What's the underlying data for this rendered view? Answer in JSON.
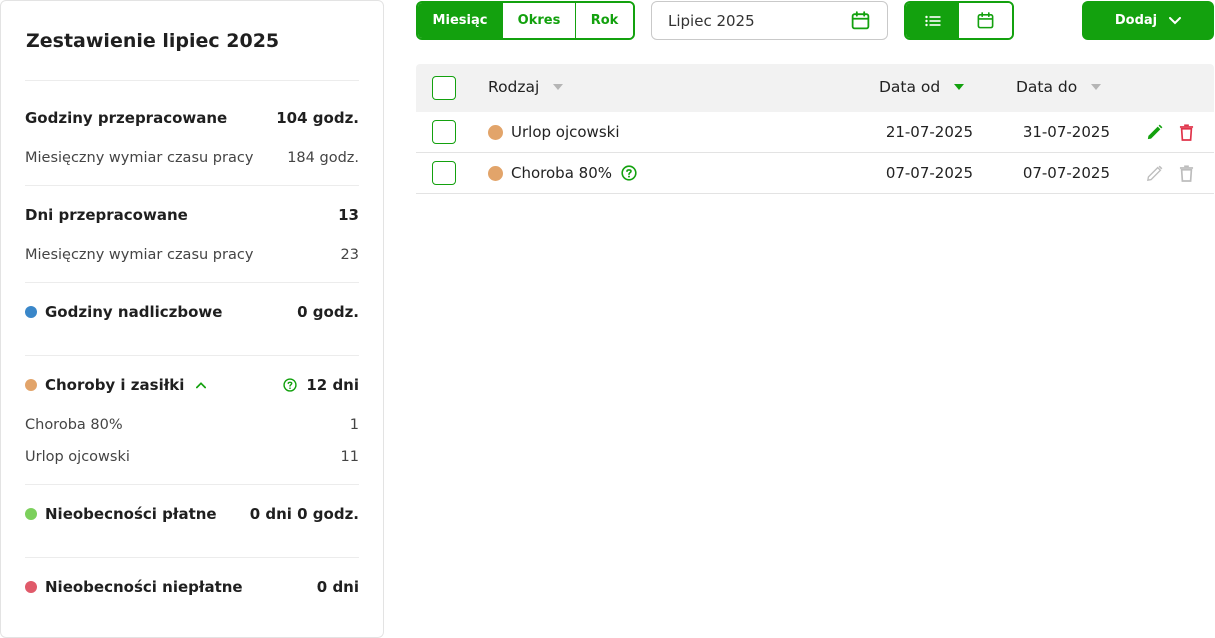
{
  "summary": {
    "title": "Zestawienie lipiec 2025",
    "worked_hours": {
      "label": "Godziny przepracowane",
      "value": "104 godz."
    },
    "monthly_hours_norm": {
      "label": "Miesięczny wymiar czasu pracy",
      "value": "184 godz."
    },
    "worked_days": {
      "label": "Dni przepracowane",
      "value": "13"
    },
    "monthly_days_norm": {
      "label": "Miesięczny wymiar czasu pracy",
      "value": "23"
    },
    "overtime": {
      "label": "Godziny nadliczbowe",
      "value": "0 godz.",
      "color": "#3a87c9"
    },
    "sickness": {
      "label": "Choroby i zasiłki",
      "value": "12 dni",
      "color": "#e2a46a",
      "items": [
        {
          "label": "Choroba 80%",
          "value": "1"
        },
        {
          "label": "Urlop ojcowski",
          "value": "11"
        }
      ]
    },
    "paid_absence": {
      "label": "Nieobecności płatne",
      "value": "0 dni 0 godz.",
      "color": "#7cd05c"
    },
    "unpaid_absence": {
      "label": "Nieobecności niepłatne",
      "value": "0 dni",
      "color": "#e05a6a"
    }
  },
  "toolbar": {
    "range_tabs": [
      "Miesiąc",
      "Okres",
      "Rok"
    ],
    "active_tab": "Miesiąc",
    "date_value": "Lipiec 2025",
    "add_label": "Dodaj"
  },
  "table": {
    "headers": {
      "type": "Rodzaj",
      "date_from": "Data od",
      "date_to": "Data do"
    },
    "sorted_column": "Data od",
    "rows": [
      {
        "type": "Urlop ojcowski",
        "date_from": "21-07-2025",
        "date_to": "31-07-2025",
        "color": "#e2a46a",
        "editable": true,
        "has_help": false
      },
      {
        "type": "Choroba 80%",
        "date_from": "07-07-2025",
        "date_to": "07-07-2025",
        "color": "#e2a46a",
        "editable": false,
        "has_help": true
      }
    ]
  },
  "colors": {
    "accent": "#13a10e",
    "danger": "#e0334a",
    "disabled": "#bdbdbd"
  }
}
